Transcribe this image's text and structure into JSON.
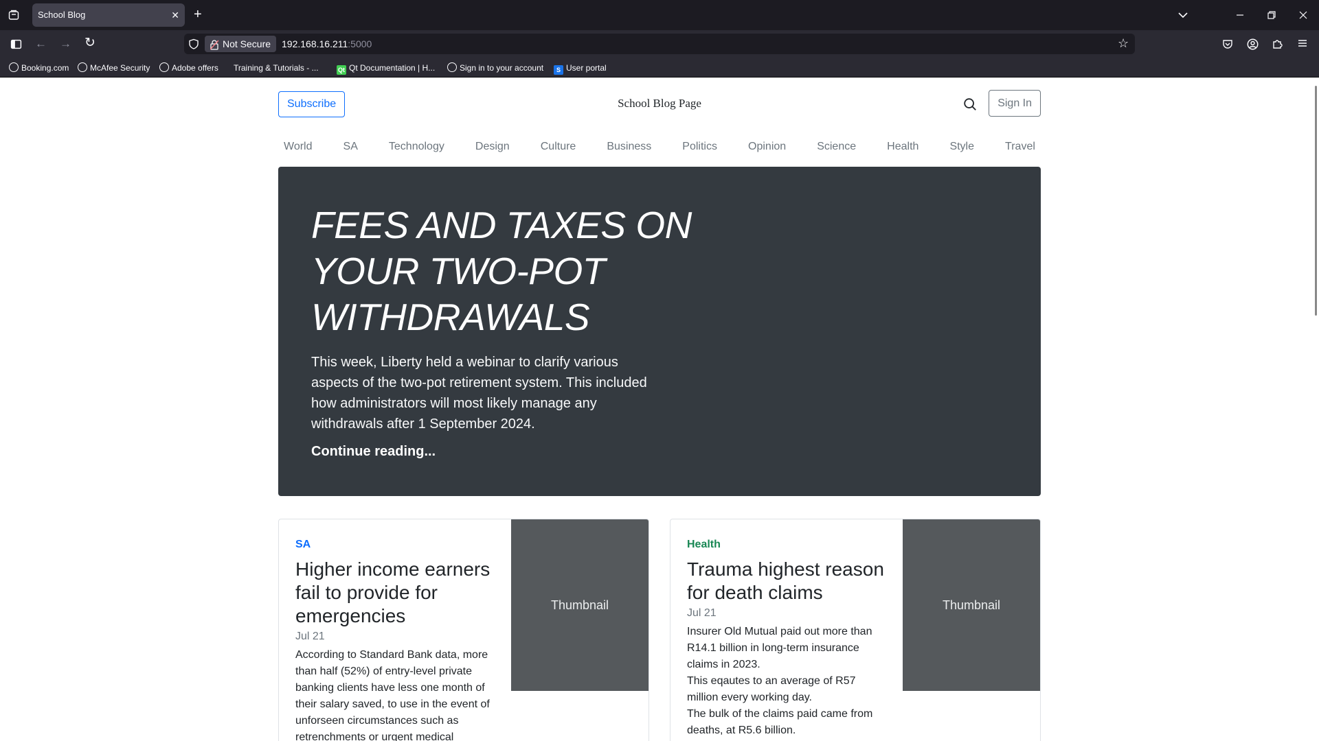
{
  "browser": {
    "tab_title": "School Blog",
    "security_label": "Not Secure",
    "url_host": "192.168.16.211",
    "url_port": ":5000",
    "bookmarks": [
      {
        "label": "Booking.com"
      },
      {
        "label": "McAfee Security"
      },
      {
        "label": "Adobe offers"
      },
      {
        "label": "Training & Tutorials - ..."
      },
      {
        "label": "Qt Documentation | H..."
      },
      {
        "label": "Sign in to your account"
      },
      {
        "label": "User portal"
      }
    ]
  },
  "header": {
    "subscribe_label": "Subscribe",
    "site_title": "School Blog Page",
    "signin_label": "Sign In"
  },
  "nav": [
    "World",
    "SA",
    "Technology",
    "Design",
    "Culture",
    "Business",
    "Politics",
    "Opinion",
    "Science",
    "Health",
    "Style",
    "Travel"
  ],
  "hero": {
    "title": "FEES AND TAXES ON YOUR TWO-POT WITHDRAWALS",
    "lead": "This week, Liberty held a webinar to clarify various aspects of the two-pot retirement system. This included how administrators will most likely manage any withdrawals after 1 September 2024.",
    "link": "Continue reading..."
  },
  "cards": [
    {
      "category": "SA",
      "category_color": "#0d6efd",
      "title": "Higher income earners fail to provide for emergencies",
      "date": "Jul 21",
      "text": "According to Standard Bank data, more than half (52%) of entry-level private banking clients have less one month of their salary saved, to use in the event of unforseen circumstances such as retrenchments or urgent medical",
      "thumb_label": "Thumbnail"
    },
    {
      "category": "Health",
      "category_color": "#198754",
      "title": "Trauma highest reason for death claims",
      "date": "Jul 21",
      "text_lines": [
        "Insurer Old Mutual paid out more than R14.1 billion in long-term insurance claims in 2023.",
        "This eqautes to an average of R57 million every working day.",
        "The bulk of the claims paid came from deaths, at R5.6 billion."
      ],
      "thumb_label": "Thumbnail"
    }
  ],
  "colors": {
    "chrome_dark": "#1c1b22",
    "chrome": "#2b2a33",
    "hero_bg": "#343a40",
    "thumb_bg": "#55595c",
    "primary": "#0d6efd",
    "success": "#198754"
  },
  "icons": [
    "tab-list-icon",
    "new-tab-icon",
    "chevron-down-icon",
    "minimize-icon",
    "restore-icon",
    "close-icon",
    "sidebar-icon",
    "back-icon",
    "forward-icon",
    "reload-icon",
    "shield-icon",
    "lock-icon",
    "star-icon",
    "pocket-icon",
    "account-icon",
    "extensions-icon",
    "menu-icon",
    "search-icon"
  ]
}
